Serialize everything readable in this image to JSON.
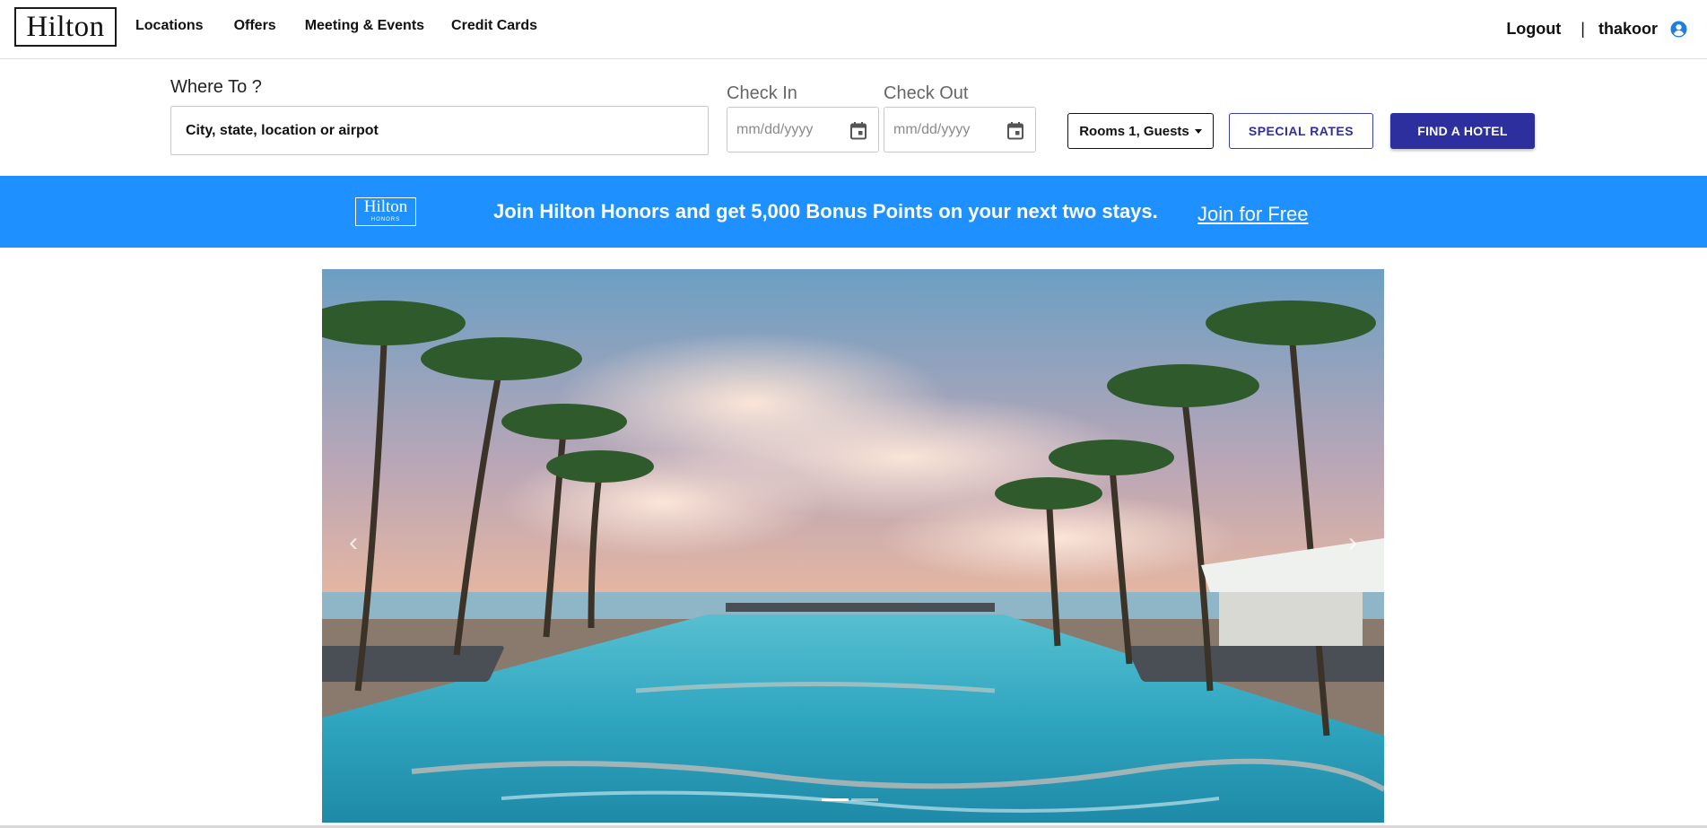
{
  "brand": {
    "logo_text": "Hilton"
  },
  "nav": {
    "links": [
      "Locations",
      "Offers",
      "Meeting & Events",
      "Credit Cards"
    ],
    "logout_label": "Logout",
    "divider": "|",
    "username": "thakoor"
  },
  "search": {
    "where_label": "Where To ?",
    "where_placeholder": "City, state, location or airpot",
    "checkin_label": "Check In",
    "checkout_label": "Check Out",
    "date_placeholder": "mm/dd/yyyy",
    "rooms_label": "Rooms 1, Guests",
    "special_rates_label": "SPECIAL RATES",
    "find_hotel_label": "FIND A HOTEL"
  },
  "banner": {
    "logo_top": "Hilton",
    "logo_bottom": "HONORS",
    "text": "Join Hilton Honors and get 5,000 Bonus Points on your next two stays.",
    "link_label": "Join for Free",
    "background": "#1e90ff"
  },
  "carousel": {
    "prev_icon": "chevron-left-icon",
    "next_icon": "chevron-right-icon",
    "slide_count": 2,
    "active_index": 0
  },
  "colors": {
    "primary_button": "#2e2f9e",
    "user_icon": "#1e7fe0"
  }
}
